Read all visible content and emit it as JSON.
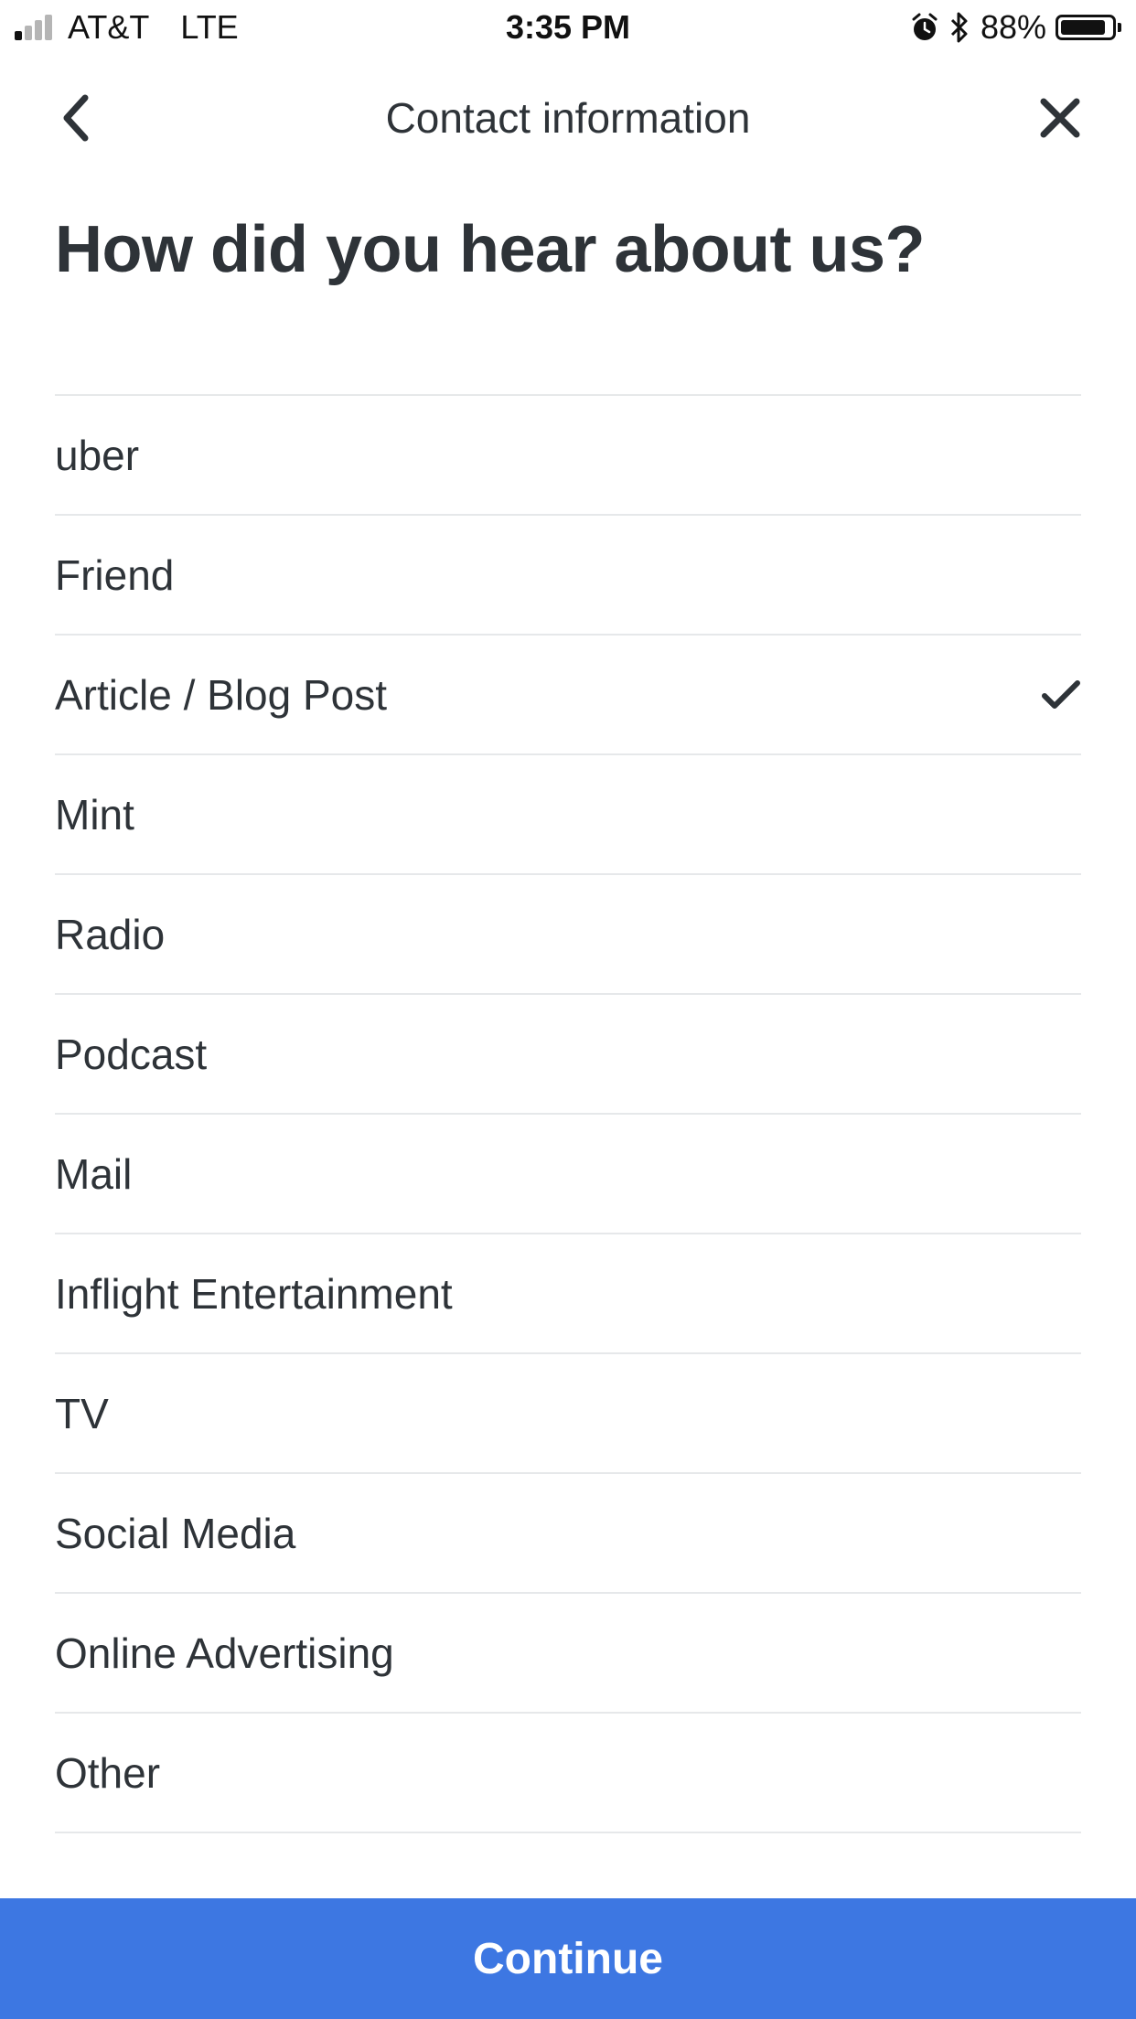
{
  "status_bar": {
    "carrier": "AT&T",
    "network": "LTE",
    "time": "3:35 PM",
    "battery_percent": "88%",
    "battery_level": 0.88,
    "signal_bars_active": 1,
    "signal_bars_total": 4,
    "icons": [
      "alarm-icon",
      "bluetooth-icon",
      "battery-icon"
    ]
  },
  "nav": {
    "title": "Contact information",
    "back_icon": "chevron-left-icon",
    "close_icon": "close-icon"
  },
  "heading": "How did you hear about us?",
  "options": [
    {
      "label": "uber",
      "selected": false
    },
    {
      "label": "Friend",
      "selected": false
    },
    {
      "label": "Article / Blog Post",
      "selected": true
    },
    {
      "label": "Mint",
      "selected": false
    },
    {
      "label": "Radio",
      "selected": false
    },
    {
      "label": "Podcast",
      "selected": false
    },
    {
      "label": "Mail",
      "selected": false
    },
    {
      "label": "Inflight Entertainment",
      "selected": false
    },
    {
      "label": "TV",
      "selected": false
    },
    {
      "label": "Social Media",
      "selected": false
    },
    {
      "label": "Online Advertising",
      "selected": false
    },
    {
      "label": "Other",
      "selected": false
    }
  ],
  "continue_label": "Continue",
  "colors": {
    "accent": "#3d77e2",
    "text": "#2e3338",
    "divider": "#e6e8ea"
  }
}
